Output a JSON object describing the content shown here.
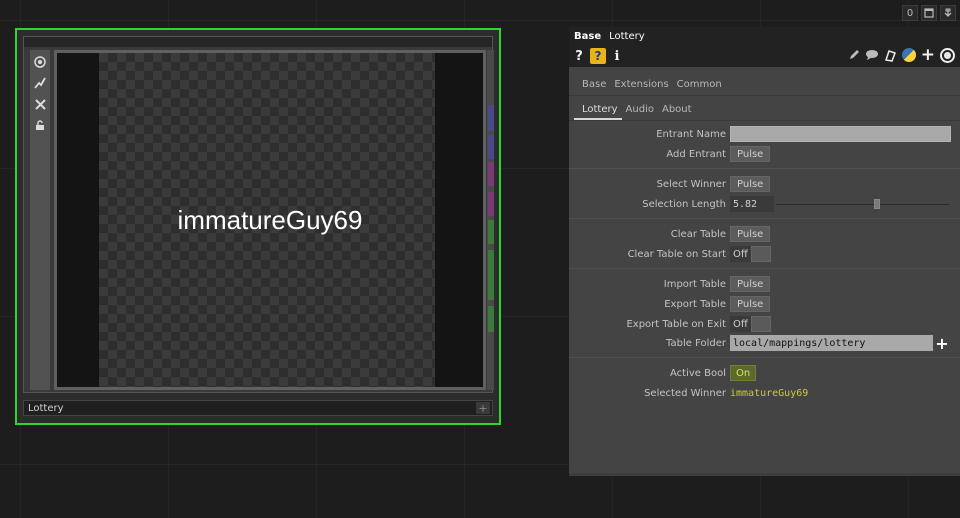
{
  "topbar": {
    "counter_label": "0",
    "window_icon": "window-icon",
    "pin_icon": "pin-down-icon"
  },
  "node": {
    "name": "Lottery",
    "viewer_text": "immatureGuy69",
    "accent_color": "#2dd62d",
    "left_icons": [
      "viewer-active-icon",
      "bypass-icon",
      "close-icon",
      "lock-icon"
    ],
    "strip_colors": [
      "#4a4a8a",
      "#4a4a8a",
      "#7a3a7a",
      "#7a3a7a",
      "#3c7a3c",
      "#3c7a3c",
      "#3c7a3c"
    ]
  },
  "panel": {
    "op_type": "Base",
    "op_name": "Lottery",
    "page_tabs_row1": [
      "Base",
      "Extensions",
      "Common"
    ],
    "page_tabs_row2": [
      "Lottery",
      "Audio",
      "About"
    ],
    "active_tab": "Lottery",
    "params": {
      "entrant_name": {
        "label": "Entrant Name",
        "value": ""
      },
      "add_entrant": {
        "label": "Add Entrant",
        "button": "Pulse"
      },
      "select_winner": {
        "label": "Select Winner",
        "button": "Pulse"
      },
      "selection_length": {
        "label": "Selection Length",
        "value": "5.82",
        "fraction": 0.6
      },
      "clear_table": {
        "label": "Clear Table",
        "button": "Pulse"
      },
      "clear_table_on_start": {
        "label": "Clear Table on Start",
        "value": "Off"
      },
      "import_table": {
        "label": "Import Table",
        "button": "Pulse"
      },
      "export_table": {
        "label": "Export Table",
        "button": "Pulse"
      },
      "export_table_on_exit": {
        "label": "Export Table on Exit",
        "value": "Off"
      },
      "table_folder": {
        "label": "Table Folder",
        "value": "local/mappings/lottery"
      },
      "active_bool": {
        "label": "Active Bool",
        "value": "On"
      },
      "selected_winner": {
        "label": "Selected Winner",
        "value": "immatureGuy69"
      }
    }
  }
}
